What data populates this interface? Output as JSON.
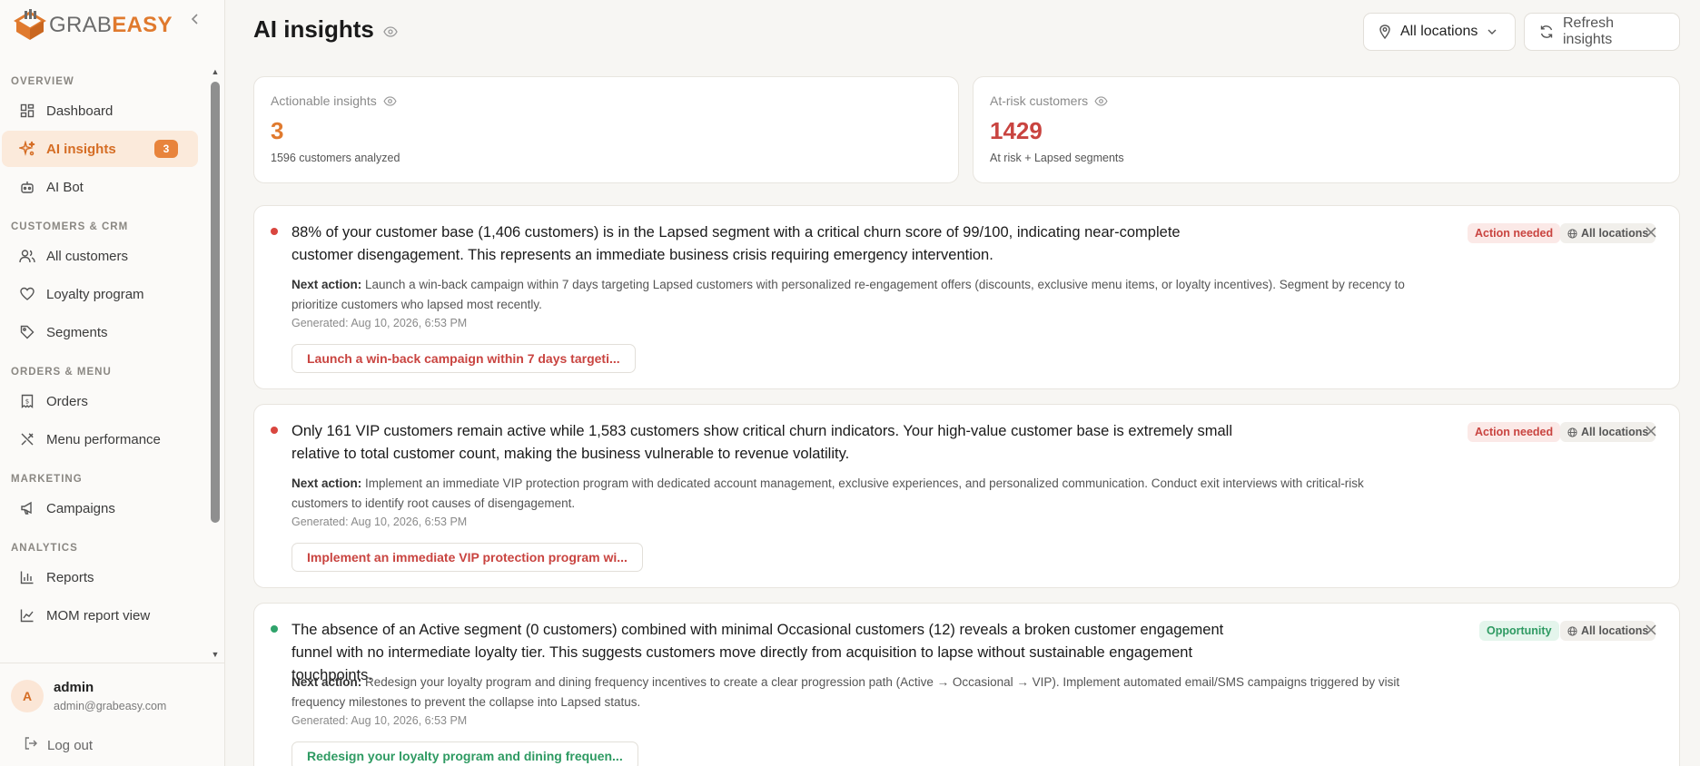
{
  "brand": {
    "name_part1": "GRAB",
    "name_part2": "EASY",
    "accent": "#e07a2e"
  },
  "sidebar": {
    "sections": [
      {
        "title": "OVERVIEW",
        "items": [
          {
            "label": "Dashboard",
            "icon": "dashboard-icon"
          },
          {
            "label": "AI insights",
            "icon": "sparkle-icon",
            "active": true,
            "badge": "3"
          },
          {
            "label": "AI Bot",
            "icon": "bot-icon"
          }
        ]
      },
      {
        "title": "CUSTOMERS & CRM",
        "items": [
          {
            "label": "All customers",
            "icon": "users-icon"
          },
          {
            "label": "Loyalty program",
            "icon": "heart-icon"
          },
          {
            "label": "Segments",
            "icon": "tag-icon"
          }
        ]
      },
      {
        "title": "ORDERS & MENU",
        "items": [
          {
            "label": "Orders",
            "icon": "receipt-icon"
          },
          {
            "label": "Menu performance",
            "icon": "utensils-icon"
          }
        ]
      },
      {
        "title": "MARKETING",
        "items": [
          {
            "label": "Campaigns",
            "icon": "megaphone-icon"
          }
        ]
      },
      {
        "title": "ANALYTICS",
        "items": [
          {
            "label": "Reports",
            "icon": "bar-chart-icon"
          },
          {
            "label": "MOM report view",
            "icon": "line-chart-icon"
          }
        ]
      }
    ],
    "user": {
      "initial": "A",
      "name": "admin",
      "email": "admin@grabeasy.com"
    },
    "logout_label": "Log out"
  },
  "header": {
    "title": "AI insights",
    "locations_label": "All locations",
    "refresh_label": "Refresh insights"
  },
  "stats": [
    {
      "label": "Actionable insights",
      "value": "3",
      "sub": "1596 customers analyzed"
    },
    {
      "label": "At-risk customers",
      "value": "1429",
      "sub": "At risk + Lapsed segments"
    }
  ],
  "insights": [
    {
      "title": "88% of your customer base (1,406 customers) is in the Lapsed segment with a critical churn score of 99/100, indicating near-complete customer disengagement. This represents an immediate business crisis requiring emergency intervention.",
      "next_action_label": "Next action:",
      "next_action": "Launch a win-back campaign within 7 days targeting Lapsed customers with personalized re-engagement offers (discounts, exclusive menu items, or loyalty incentives). Segment by recency to prioritize customers who lapsed most recently.",
      "generated": "Generated: Aug 10, 2026, 6:53 PM",
      "action_button": "Launch a win-back campaign within 7 days targeti...",
      "tag": "Action needed",
      "location": "All locations"
    },
    {
      "title": "Only 161 VIP customers remain active while 1,583 customers show critical churn indicators. Your high-value customer base is extremely small relative to total customer count, making the business vulnerable to revenue volatility.",
      "next_action_label": "Next action:",
      "next_action": "Implement an immediate VIP protection program with dedicated account management, exclusive experiences, and personalized communication. Conduct exit interviews with critical-risk customers to identify root causes of disengagement.",
      "generated": "Generated: Aug 10, 2026, 6:53 PM",
      "action_button": "Implement an immediate VIP protection program wi...",
      "tag": "Action needed",
      "location": "All locations"
    },
    {
      "title": "The absence of an Active segment (0 customers) combined with minimal Occasional customers (12) reveals a broken customer engagement funnel with no intermediate loyalty tier. This suggests customers move directly from acquisition to lapse without sustainable engagement touchpoints.",
      "next_action_label": "Next action:",
      "next_action": "Redesign your loyalty program and dining frequency incentives to create a clear progression path (Active → Occasional → VIP). Implement automated email/SMS campaigns triggered by visit frequency milestones to prevent the collapse into Lapsed status.",
      "generated": "Generated: Aug 10, 2026, 6:53 PM",
      "action_button": "Redesign your loyalty program and dining frequen...",
      "tag": "Opportunity",
      "location": "All locations"
    }
  ]
}
